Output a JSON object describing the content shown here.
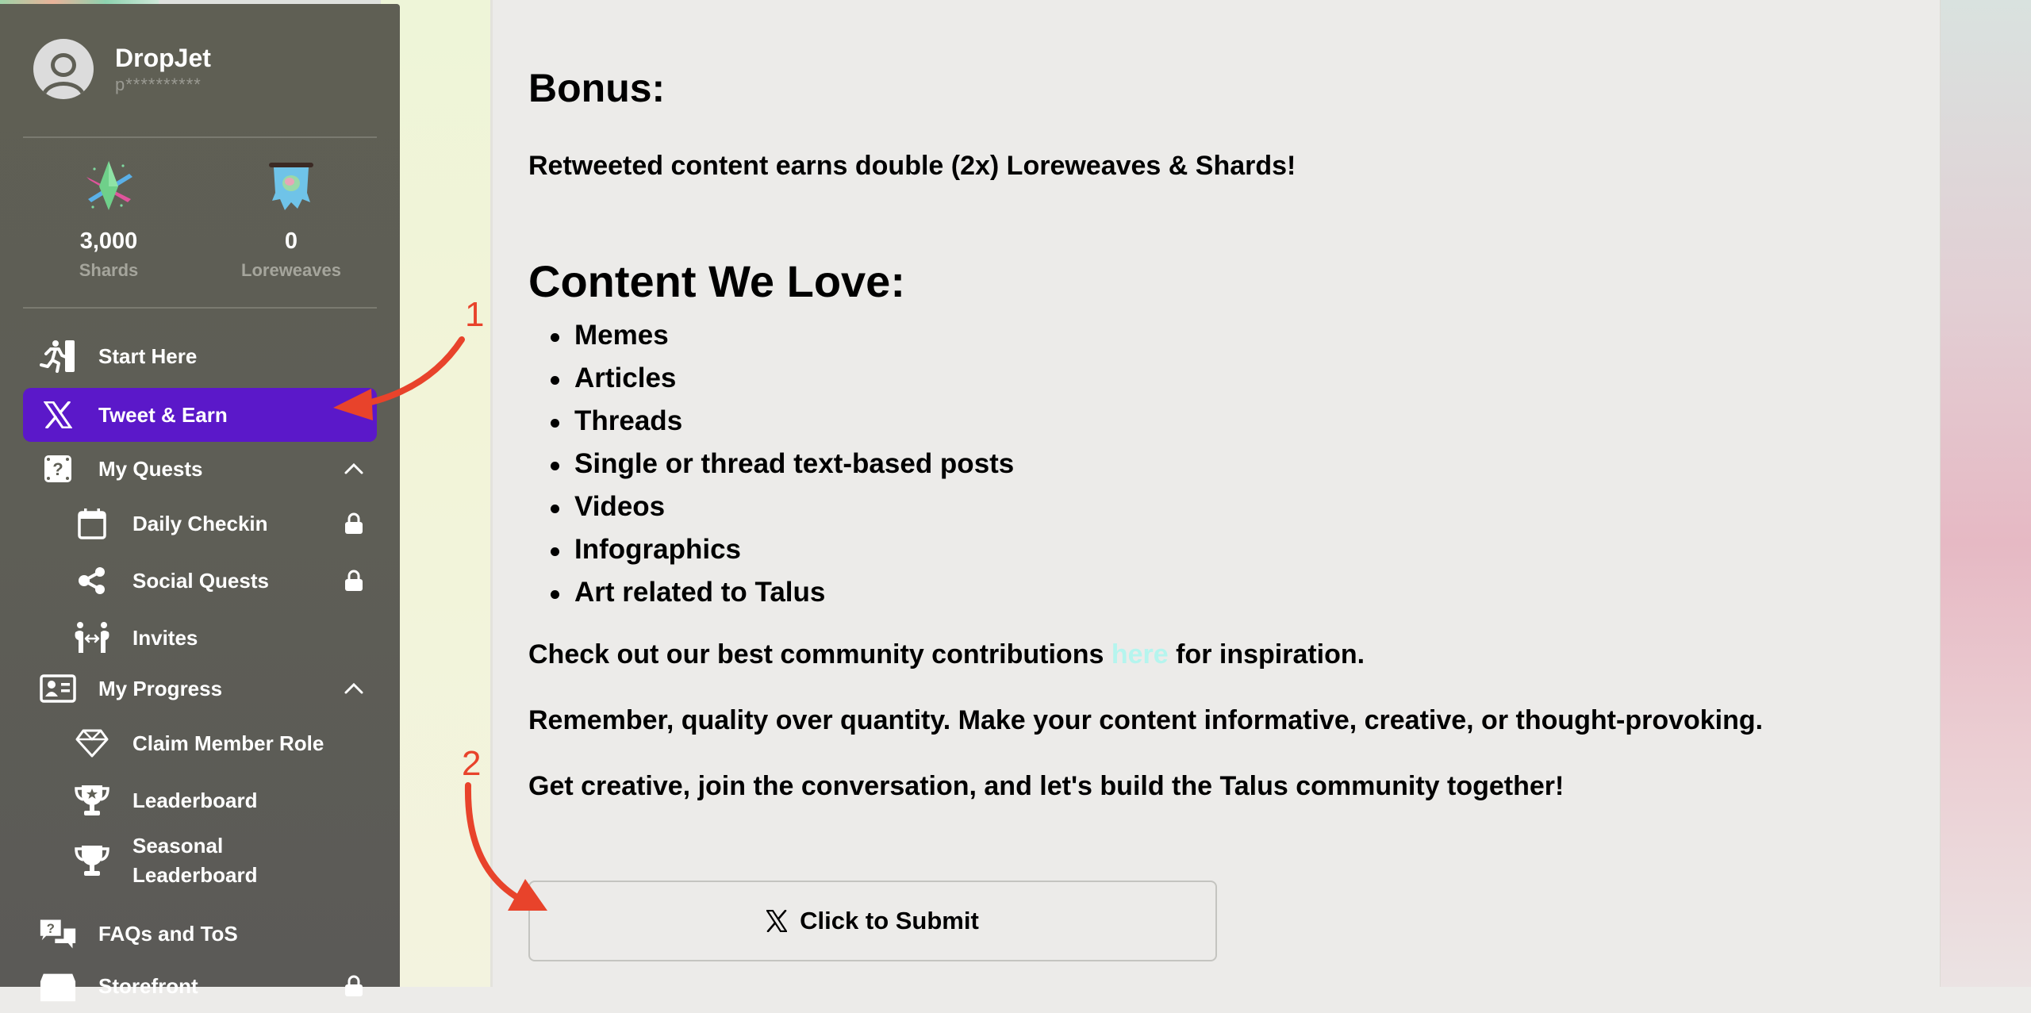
{
  "profile": {
    "username": "DropJet",
    "masked_handle": "p**********",
    "avatar_icon": "user-avatar-icon"
  },
  "stats": [
    {
      "value": "3,000",
      "label": "Shards",
      "icon": "shard-crystal-icon"
    },
    {
      "value": "0",
      "label": "Loreweaves",
      "icon": "loreweave-banner-icon"
    }
  ],
  "nav": {
    "start_here": {
      "label": "Start Here",
      "icon": "running-exit-icon"
    },
    "tweet_earn": {
      "label": "Tweet & Earn",
      "icon": "x-logo-icon",
      "active": true
    },
    "my_quests": {
      "label": "My Quests",
      "icon": "question-box-icon",
      "expanded": true
    },
    "daily_checkin": {
      "label": "Daily Checkin",
      "icon": "calendar-icon",
      "locked": true
    },
    "social_quests": {
      "label": "Social Quests",
      "icon": "share-icon",
      "locked": true
    },
    "invites": {
      "label": "Invites",
      "icon": "invite-people-icon"
    },
    "my_progress": {
      "label": "My Progress",
      "icon": "id-card-icon",
      "expanded": true
    },
    "claim_member_role": {
      "label": "Claim Member Role",
      "icon": "diamond-icon"
    },
    "leaderboard": {
      "label": "Leaderboard",
      "icon": "trophy-star-icon"
    },
    "seasonal_leaderboard": {
      "label_line1": "Seasonal",
      "label_line2": "Leaderboard",
      "icon": "trophy-icon"
    },
    "faqs": {
      "label": "FAQs and ToS",
      "icon": "faq-chat-icon"
    },
    "storefront": {
      "label": "Storefront",
      "icon": "store-icon",
      "locked": true
    }
  },
  "main": {
    "bonus_heading": "Bonus:",
    "bonus_text": "Retweeted content earns double (2x) Loreweaves & Shards!",
    "love_heading": "Content We Love:",
    "love_items": [
      "Memes",
      "Articles",
      "Threads",
      "Single or thread text-based posts",
      "Videos",
      "Infographics",
      "Art related to Talus"
    ],
    "check_out_prefix": "Check out our best community contributions ",
    "check_out_link": "here",
    "check_out_suffix": " for inspiration.",
    "remember_text": "Remember, quality over quantity. Make your content informative, creative, or thought-provoking.",
    "get_creative_text": "Get creative, join the conversation, and let's build the Talus community together!",
    "submit_label": "Click to Submit"
  },
  "annotations": {
    "step1": "1",
    "step2": "2"
  },
  "colors": {
    "active_nav": "#5b18c9",
    "sidebar_bg": "#5f5f55",
    "link": "#b5f5ee",
    "annotation": "#e8432b"
  }
}
